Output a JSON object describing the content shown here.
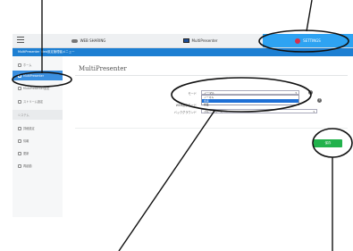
{
  "tabs": [
    {
      "label": "WEB SHARING",
      "icon": "cloud-icon"
    },
    {
      "label": "MultiPresenter",
      "icon": "monitor-icon"
    },
    {
      "label": "SETTINGS",
      "icon": "gear-icon"
    }
  ],
  "header": {
    "title": "MultiPresenter Web設定管理者メニュー"
  },
  "sidebar": {
    "items": [
      {
        "label": "ホーム"
      },
      {
        "label": "MultiPresenter"
      },
      {
        "label": "MultiPresenter設定"
      },
      {
        "label": "ストリーム設定"
      },
      {
        "label": "システム"
      },
      {
        "label": "詳細設定"
      },
      {
        "label": "情報"
      },
      {
        "label": "更新"
      },
      {
        "label": "再起動"
      }
    ]
  },
  "main": {
    "title": "MultiPresenter",
    "mode_label": "モード",
    "mode_value": "ノーマル",
    "mode_options": [
      "ノーマル",
      "会議",
      "授業"
    ],
    "web_label": "WEB表示モード",
    "background_label": "バックグラウンド",
    "background_value": "ブルー・ベース",
    "help_glyph": "?",
    "save_label": "保存"
  },
  "colors": {
    "accent": "#2ea3f2",
    "header": "#1d7fd2",
    "save": "#22b24c",
    "callout": "#111111"
  }
}
